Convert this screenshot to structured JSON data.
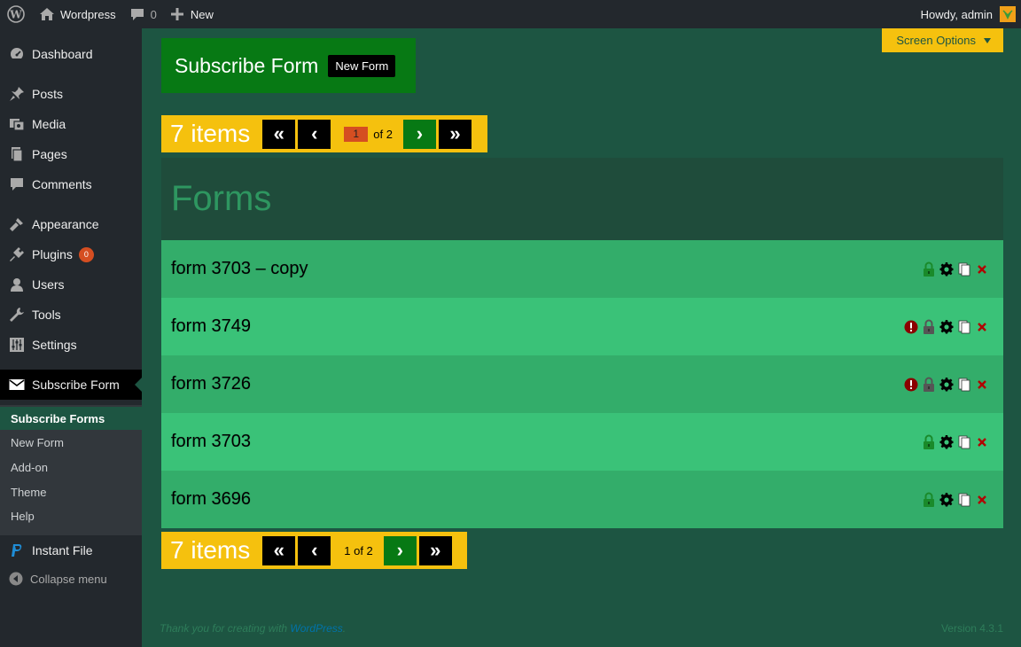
{
  "adminbar": {
    "site_name": "Wordpress",
    "comments_count": "0",
    "new_label": "New",
    "howdy": "Howdy, admin"
  },
  "sidebar": {
    "items": [
      {
        "label": "Dashboard",
        "icon": "dashboard-icon"
      },
      {
        "label": "Posts",
        "icon": "pin-icon"
      },
      {
        "label": "Media",
        "icon": "media-icon"
      },
      {
        "label": "Pages",
        "icon": "pages-icon"
      },
      {
        "label": "Comments",
        "icon": "comment-icon"
      },
      {
        "label": "Appearance",
        "icon": "brush-icon"
      },
      {
        "label": "Plugins",
        "icon": "plugin-icon",
        "badge": "0"
      },
      {
        "label": "Users",
        "icon": "user-icon"
      },
      {
        "label": "Tools",
        "icon": "wrench-icon"
      },
      {
        "label": "Settings",
        "icon": "settings-icon"
      },
      {
        "label": "Subscribe Form",
        "icon": "envelope-icon"
      }
    ],
    "submenu": [
      "Subscribe Forms",
      "New Form",
      "Add-on",
      "Theme",
      "Help"
    ],
    "instant_file": "Instant File",
    "collapse": "Collapse menu"
  },
  "screen_options": "Screen Options",
  "heading": {
    "title": "Subscribe Form",
    "new_form_button": "New Form"
  },
  "pagination_top": {
    "count": "7 items",
    "first": "«",
    "prev": "‹",
    "current_page": "1",
    "of": "of 2",
    "next": "›",
    "last": "»"
  },
  "pagination_bottom": {
    "count": "7 items",
    "first": "«",
    "prev": "‹",
    "page_text": "1 of 2",
    "next": "›",
    "last": "»"
  },
  "forms_title": "Forms",
  "forms": [
    {
      "name": "form 3703 – copy",
      "warning": false,
      "locked": true
    },
    {
      "name": "form 3749",
      "warning": true,
      "locked": false
    },
    {
      "name": "form 3726",
      "warning": true,
      "locked": false
    },
    {
      "name": "form 3703",
      "warning": false,
      "locked": true
    },
    {
      "name": "form 3696",
      "warning": false,
      "locked": true
    }
  ],
  "footer": {
    "thanks_prefix": "Thank you for creating with ",
    "wordpress_link": "WordPress",
    "thanks_suffix": ".",
    "version": "Version 4.3.1"
  },
  "colors": {
    "page_bg": "#1d5542",
    "accent_yellow": "#f5c10e",
    "heading_green": "#077914",
    "row_dark": "#33ad6a",
    "row_light": "#3ac278",
    "warning_red": "#8b0000"
  }
}
